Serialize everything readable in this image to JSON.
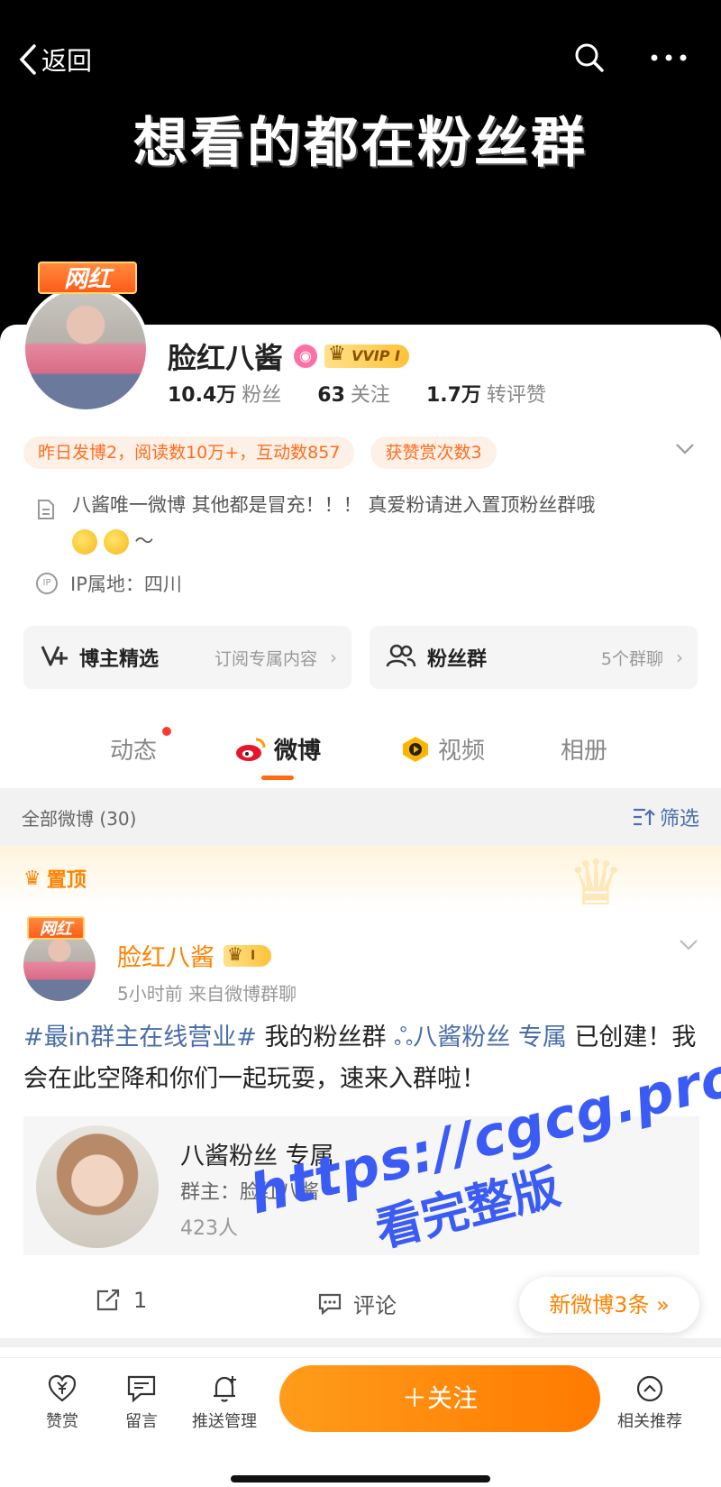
{
  "nav": {
    "back_label": "返回"
  },
  "banner": {
    "text": "想看的都在粉丝群"
  },
  "profile": {
    "badge": "网红",
    "name": "脸红八酱",
    "vip_label": "VVIP I",
    "stats": [
      {
        "value": "10.4万",
        "label": "粉丝"
      },
      {
        "value": "63",
        "label": "关注"
      },
      {
        "value": "1.7万",
        "label": "转评赞"
      }
    ],
    "tags": [
      "昨日发博2，阅读数10万+，互动数857",
      "获赞赏次数3"
    ],
    "bio": "八酱唯一微博 其他都是冒充！！！ 真爱粉请进入置顶粉丝群哦",
    "bio_suffix": "～",
    "ip": "IP属地：四川"
  },
  "features": [
    {
      "label": "博主精选",
      "sub": "订阅专属内容",
      "arrow": "›"
    },
    {
      "label": "粉丝群",
      "sub": "5个群聊",
      "arrow": "›"
    }
  ],
  "tabs": [
    "动态",
    "微博",
    "视频",
    "相册"
  ],
  "filter": {
    "left": "全部微博 (30)",
    "right": "筛选"
  },
  "pinned": {
    "label": "置顶"
  },
  "post": {
    "badge": "网红",
    "author": "脸红八酱",
    "vip_label": "I",
    "meta": "5小时前  来自微博群聊",
    "hashtag": "#最in群主在线营业#",
    "text_1": " 我的粉丝群 ",
    "group_link": "八酱粉丝 专属",
    "text_2": " 已创建！我会在此空降和你们一起玩耍，速来入群啦！",
    "group": {
      "name": "八酱粉丝 专属",
      "owner": "群主：脸红八酱",
      "count": "423人"
    },
    "repost_count": "1",
    "comment_label": "评论",
    "new_posts": "新微博3条"
  },
  "watermark": {
    "line1": "https://cgcg.pro",
    "line2": "看完整版"
  },
  "bottom_bar": {
    "items": [
      "赞赏",
      "留言",
      "推送管理",
      "相关推荐"
    ],
    "follow": "＋关注"
  },
  "colors": {
    "accent": "#ff8200",
    "link": "#4a6ea8",
    "watermark": "#3b5bf5"
  }
}
